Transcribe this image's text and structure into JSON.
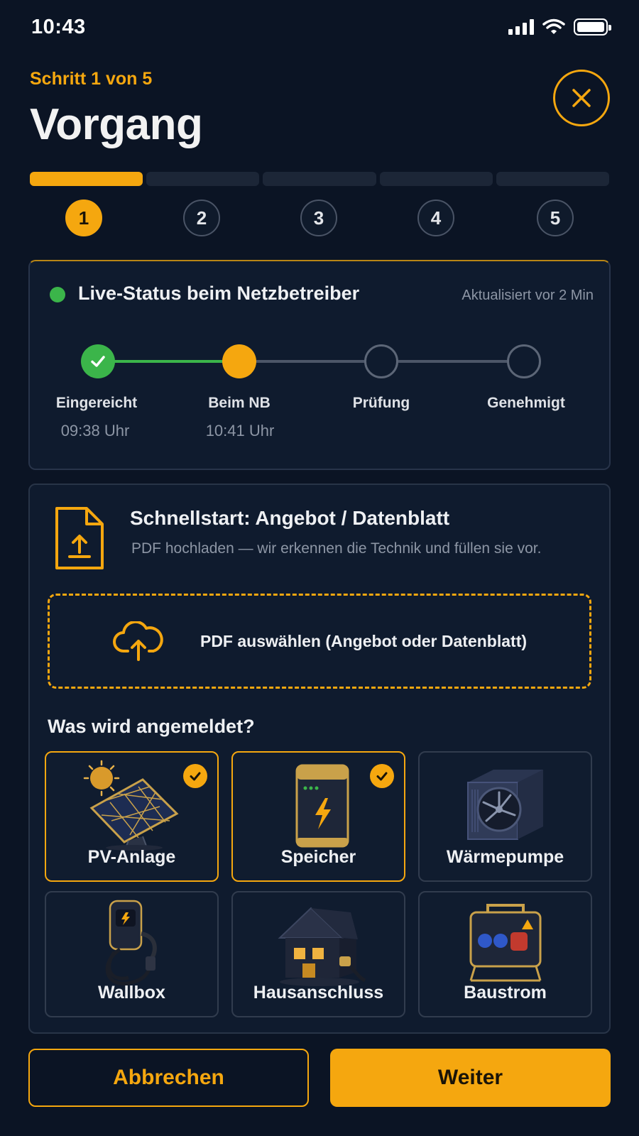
{
  "status_bar": {
    "time": "10:43"
  },
  "header": {
    "step_label": "Schritt 1 von 5",
    "title": "Vorgang"
  },
  "stepper": {
    "current": 1,
    "total": 5,
    "steps": [
      "1",
      "2",
      "3",
      "4",
      "5"
    ]
  },
  "live_status": {
    "title": "Live-Status beim Netzbetreiber",
    "updated": "Aktualisiert vor 2 Min",
    "stages": [
      {
        "label": "Eingereicht",
        "time": "09:38 Uhr",
        "state": "done"
      },
      {
        "label": "Beim NB",
        "time": "10:41 Uhr",
        "state": "current"
      },
      {
        "label": "Prüfung",
        "time": "",
        "state": "todo"
      },
      {
        "label": "Genehmigt",
        "time": "",
        "state": "todo"
      }
    ]
  },
  "quickstart": {
    "title": "Schnellstart: Angebot / Datenblatt",
    "subtitle": "PDF hochladen — wir erkennen die Technik und füllen sie vor.",
    "dropzone_label": "PDF auswählen (Angebot oder Datenblatt)"
  },
  "registration": {
    "question": "Was wird angemeldet?",
    "options": [
      {
        "label": "PV-Anlage",
        "selected": true,
        "icon": "solar-panel-icon"
      },
      {
        "label": "Speicher",
        "selected": true,
        "icon": "battery-storage-icon"
      },
      {
        "label": "Wärmepumpe",
        "selected": false,
        "icon": "heat-pump-icon"
      },
      {
        "label": "Wallbox",
        "selected": false,
        "icon": "wallbox-icon"
      },
      {
        "label": "Hausanschluss",
        "selected": false,
        "icon": "house-connection-icon"
      },
      {
        "label": "Baustrom",
        "selected": false,
        "icon": "construction-power-icon"
      }
    ]
  },
  "footer": {
    "cancel_label": "Abbrechen",
    "next_label": "Weiter"
  },
  "colors": {
    "accent": "#f5a70f",
    "background": "#0b1424",
    "success": "#3bb54a"
  }
}
